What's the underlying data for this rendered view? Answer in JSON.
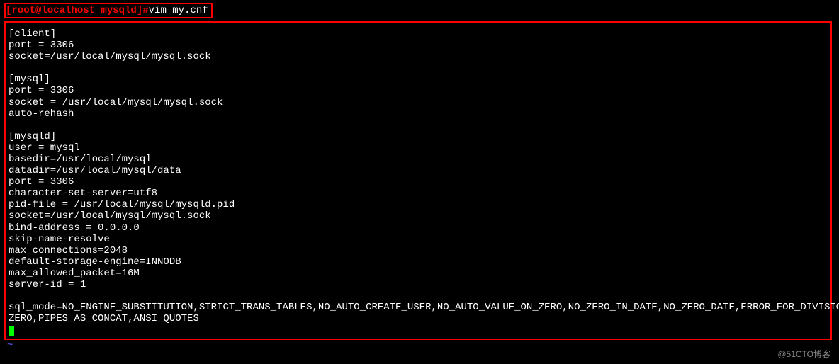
{
  "prompt": {
    "user_host": "[root@localhost mysqld]#",
    "command": "vim my.cnf"
  },
  "file_lines": [
    "[client]",
    "port = 3306",
    "socket=/usr/local/mysql/mysql.sock",
    "",
    "[mysql]",
    "port = 3306",
    "socket = /usr/local/mysql/mysql.sock",
    "auto-rehash",
    "",
    "[mysqld]",
    "user = mysql",
    "basedir=/usr/local/mysql",
    "datadir=/usr/local/mysql/data",
    "port = 3306",
    "character-set-server=utf8",
    "pid-file = /usr/local/mysql/mysqld.pid",
    "socket=/usr/local/mysql/mysql.sock",
    "bind-address = 0.0.0.0",
    "skip-name-resolve",
    "max_connections=2048",
    "default-storage-engine=INNODB",
    "max_allowed_packet=16M",
    "server-id = 1",
    "",
    "sql_mode=NO_ENGINE_SUBSTITUTION,STRICT_TRANS_TABLES,NO_AUTO_CREATE_USER,NO_AUTO_VALUE_ON_ZERO,NO_ZERO_IN_DATE,NO_ZERO_DATE,ERROR_FOR_DIVISION_BY_",
    "ZERO,PIPES_AS_CONCAT,ANSI_QUOTES"
  ],
  "tilde": "~",
  "watermark": "@51CTO博客"
}
